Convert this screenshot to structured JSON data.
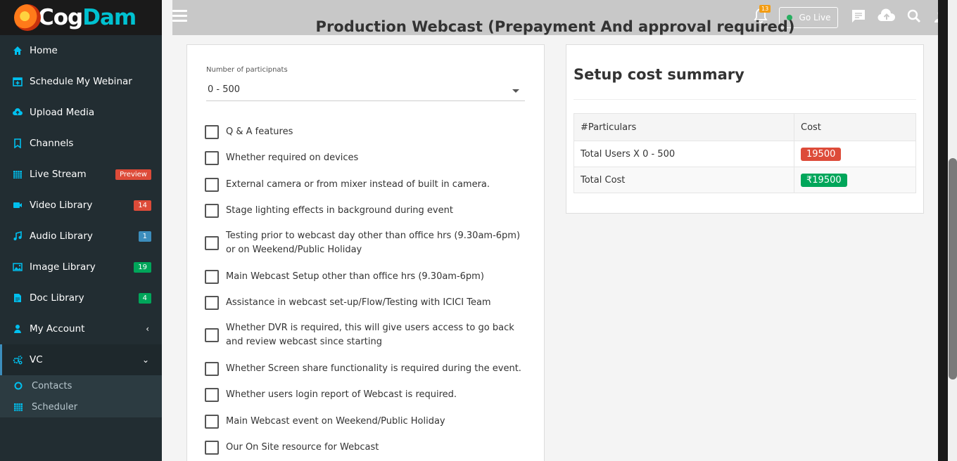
{
  "app": {
    "logo": {
      "part1": "Cog",
      "part2": "Dam"
    }
  },
  "sidebar": {
    "items": [
      {
        "label": "Home",
        "icon": "home-icon"
      },
      {
        "label": "Schedule My Webinar",
        "icon": "calendar-plus-icon"
      },
      {
        "label": "Upload Media",
        "icon": "cloud-upload-icon"
      },
      {
        "label": "Channels",
        "icon": "bookmark-icon"
      },
      {
        "label": "Live Stream",
        "icon": "calendar-icon",
        "badge": "Preview"
      },
      {
        "label": "Video Library",
        "icon": "video-icon",
        "badge": "14"
      },
      {
        "label": "Audio Library",
        "icon": "music-icon",
        "badge": "1"
      },
      {
        "label": "Image Library",
        "icon": "image-icon",
        "badge": "19"
      },
      {
        "label": "Doc Library",
        "icon": "document-icon",
        "badge": "4"
      },
      {
        "label": "My Account",
        "icon": "user-icon",
        "chevron": "‹"
      },
      {
        "label": "VC",
        "icon": "gears-icon",
        "chevron": "⌄"
      }
    ],
    "submenu": [
      {
        "label": "Contacts",
        "icon": "circle-icon"
      },
      {
        "label": "Scheduler",
        "icon": "calendar-icon"
      }
    ]
  },
  "topbar": {
    "notification_count": "13",
    "go_live_label": "Go Live"
  },
  "page": {
    "title": "Production Webcast (Prepayment And approval required)"
  },
  "form": {
    "participants_label": "Number of participnats",
    "participants_value": "0 - 500",
    "options": [
      "Q & A features",
      "Whether required on devices",
      "External camera or from mixer instead of built in camera.",
      "Stage lighting effects in background during event",
      "Testing prior to  webcast day  other than office hrs (9.30am-6pm) or on  Weekend/Public Holiday",
      "Main Webcast Setup other than office hrs (9.30am-6pm)",
      "Assistance in webcast set-up/Flow/Testing with ICICI Team",
      "Whether DVR is required, this will give users access to go back and review webcast since starting",
      "Whether Screen share functionality is required during the event.",
      "Whether users login report of Webcast   is required.",
      "Main Webcast event on Weekend/Public Holiday",
      "Our On Site resource for Webcast"
    ]
  },
  "summary": {
    "title": "Setup cost summary",
    "headers": [
      "#Particulars",
      "Cost"
    ],
    "rows": [
      {
        "particular": "Total Users X 0 - 500",
        "cost": "19500",
        "color": "#dd4b39"
      },
      {
        "particular": "Total Cost",
        "cost": "₹19500",
        "color": "#00a65a"
      }
    ]
  },
  "colors": {
    "sidebar_bg": "#222d32",
    "accent": "#3c8dbc",
    "badge_red": "#dd4b39",
    "badge_green": "#00a65a"
  }
}
